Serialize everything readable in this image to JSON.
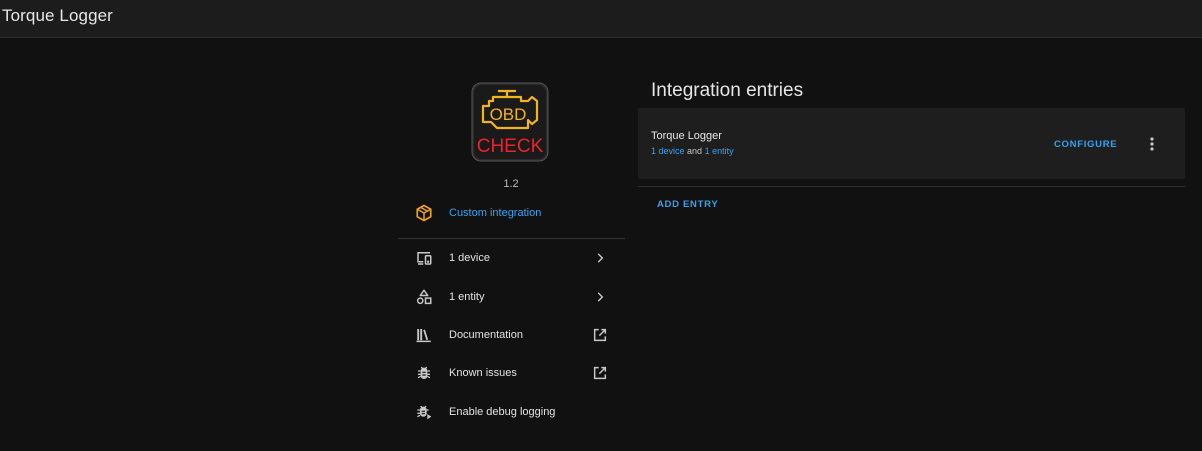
{
  "header": {
    "title": "Torque Logger"
  },
  "integration": {
    "logo": {
      "top_text": "OBD",
      "bottom_text": "CHECK",
      "name": "obd-check-logo"
    },
    "version": "1.2",
    "custom_label": "Custom integration",
    "links": [
      {
        "label": "1 device",
        "icon": "devices-icon",
        "trail": "chevron-right-icon"
      },
      {
        "label": "1 entity",
        "icon": "shapes-icon",
        "trail": "chevron-right-icon"
      },
      {
        "label": "Documentation",
        "icon": "book-shelf-icon",
        "trail": "open-in-new-icon"
      },
      {
        "label": "Known issues",
        "icon": "bug-icon",
        "trail": "open-in-new-icon"
      },
      {
        "label": "Enable debug logging",
        "icon": "bug-play-icon",
        "trail": ""
      }
    ]
  },
  "entries": {
    "title": "Integration entries",
    "items": [
      {
        "name": "Torque Logger",
        "device_link": "1 device",
        "and_text": "and",
        "entity_link": "1 entity",
        "configure_label": "CONFIGURE"
      }
    ],
    "add_entry_label": "ADD ENTRY"
  },
  "colors": {
    "accent": "#35a3f0",
    "custom_icon": "#f0a020",
    "background": "#111111",
    "card": "#1e1e1e"
  }
}
